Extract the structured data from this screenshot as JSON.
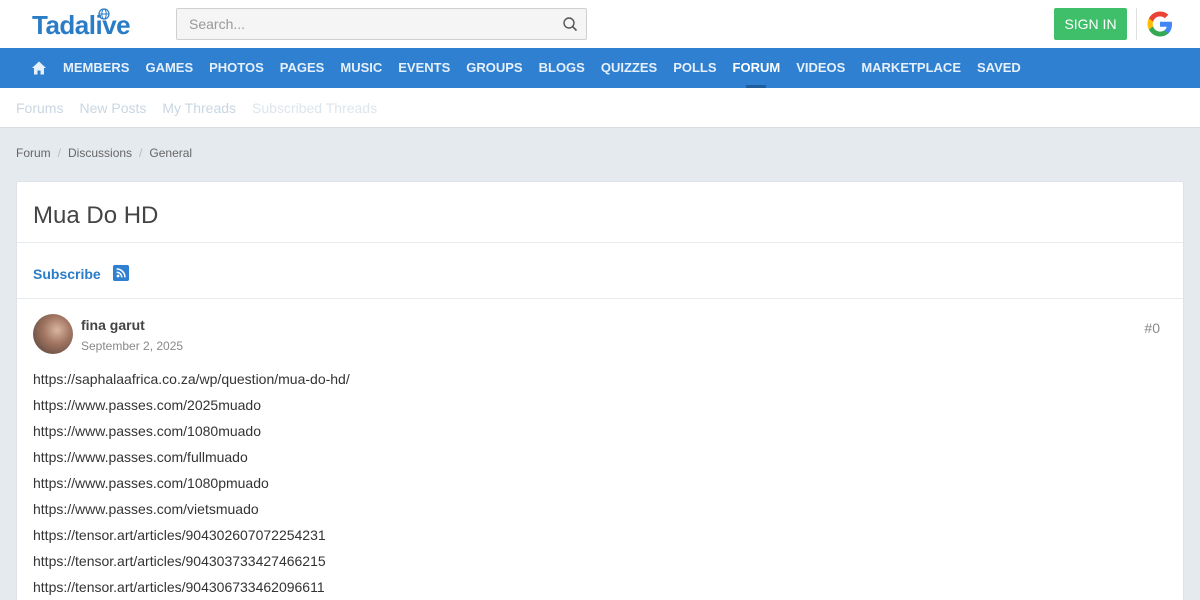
{
  "header": {
    "logo_text": "Tadalive",
    "search_placeholder": "Search...",
    "signin_label": "SIGN IN",
    "icons": {
      "search": "search-icon",
      "google": "google-icon",
      "globe": "globe-icon"
    }
  },
  "nav": {
    "home_icon": "home-icon",
    "items": [
      {
        "label": "MEMBERS"
      },
      {
        "label": "GAMES"
      },
      {
        "label": "PHOTOS"
      },
      {
        "label": "PAGES"
      },
      {
        "label": "MUSIC"
      },
      {
        "label": "EVENTS"
      },
      {
        "label": "GROUPS"
      },
      {
        "label": "BLOGS"
      },
      {
        "label": "QUIZZES"
      },
      {
        "label": "POLLS"
      },
      {
        "label": "FORUM",
        "active": true
      },
      {
        "label": "VIDEOS"
      },
      {
        "label": "MARKETPLACE"
      },
      {
        "label": "SAVED"
      }
    ]
  },
  "subnav": {
    "items": [
      {
        "label": "Forums"
      },
      {
        "label": "New Posts"
      },
      {
        "label": "My Threads"
      },
      {
        "label": "Subscribed Threads"
      }
    ]
  },
  "breadcrumb": [
    "Forum",
    "Discussions",
    "General"
  ],
  "thread": {
    "title": "Mua Do HD",
    "subscribe_label": "Subscribe",
    "rss_icon": "rss-icon"
  },
  "post": {
    "author": "fina garut",
    "date": "September 2, 2025",
    "number": "#0",
    "lines": [
      "https://saphalaafrica.co.za/wp/question/mua-do-hd/",
      "https://www.passes.com/2025muado",
      "https://www.passes.com/1080muado",
      "https://www.passes.com/fullmuado",
      "https://www.passes.com/1080pmuado",
      "https://www.passes.com/vietsmuado",
      "https://tensor.art/articles/904302607072254231",
      "https://tensor.art/articles/904303733427466215",
      "https://tensor.art/articles/904306733462096611"
    ]
  },
  "colors": {
    "brand_blue": "#2f80d1",
    "signin_green": "#3fbf6a",
    "link_blue": "#2b7cc6"
  }
}
